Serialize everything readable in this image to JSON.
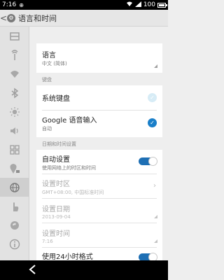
{
  "status": {
    "time": "7:16",
    "battery": "100"
  },
  "appbar": {
    "back_glyph": "<",
    "title": "语言和时间",
    "icon": "settings-gear-icon"
  },
  "sidebar": {
    "items": [
      {
        "icon": "storage-icon"
      },
      {
        "icon": "signal-icon"
      },
      {
        "icon": "wifi-icon"
      },
      {
        "icon": "bluetooth-icon"
      },
      {
        "icon": "brightness-icon"
      },
      {
        "icon": "volume-icon"
      },
      {
        "icon": "apps-grid-icon"
      },
      {
        "icon": "location-lock-icon"
      },
      {
        "icon": "globe-icon",
        "active": true
      },
      {
        "icon": "gesture-hand-icon"
      },
      {
        "icon": "sync-icon"
      },
      {
        "icon": "info-icon"
      }
    ]
  },
  "language": {
    "title": "语言",
    "value": "中文 (简体)"
  },
  "keyboard": {
    "section": "键盘",
    "system_keyboard": "系统键盘",
    "google_input": {
      "title": "Google 语音输入",
      "value": "自动"
    }
  },
  "datetime": {
    "section": "日期和时间设置",
    "auto": {
      "title": "自动设置",
      "value": "使用网络上的时区和时间"
    },
    "timezone": {
      "title": "设置时区",
      "value": "GMT+08:00, 中国标准时间"
    },
    "date": {
      "title": "设置日期",
      "value": "2013-09-04"
    },
    "time": {
      "title": "设置时间",
      "value": "7:16"
    },
    "format24": {
      "title": "使用24小时格式"
    }
  },
  "colors": {
    "accent": "#1a7fc9",
    "toggle": "#1e6fb4"
  }
}
